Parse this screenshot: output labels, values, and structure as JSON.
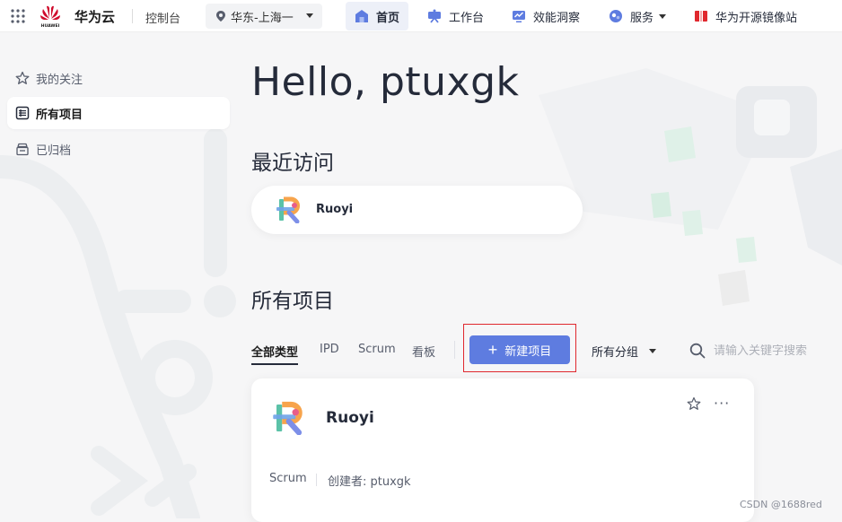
{
  "topbar": {
    "brand": "华为云",
    "logo_text": "HUAWEI",
    "console": "控制台",
    "region": "华东-上海一",
    "nav": [
      {
        "label": "首页",
        "icon": "home-icon"
      },
      {
        "label": "工作台",
        "icon": "workbench-icon"
      },
      {
        "label": "效能洞察",
        "icon": "insight-icon"
      },
      {
        "label": "服务",
        "icon": "service-icon"
      },
      {
        "label": "华为开源镜像站",
        "icon": "mirror-icon"
      }
    ]
  },
  "sidebar": {
    "items": [
      {
        "label": "我的关注",
        "icon": "star-icon"
      },
      {
        "label": "所有项目",
        "icon": "project-list-icon"
      },
      {
        "label": "已归档",
        "icon": "archive-icon"
      }
    ]
  },
  "main": {
    "greeting": "Hello, ptuxgk",
    "recent_title": "最近访问",
    "recent_items": [
      {
        "name": "Ruoyi"
      }
    ],
    "all_title": "所有项目",
    "filters": [
      "全部类型",
      "IPD",
      "Scrum",
      "看板"
    ],
    "new_project_label": "新建项目",
    "group_select": "所有分组",
    "search_placeholder": "请输入关键字搜索",
    "projects": [
      {
        "name": "Ruoyi",
        "type": "Scrum",
        "creator": "创建者: ptuxgk",
        "more": "···"
      }
    ]
  },
  "watermark": "CSDN @1688red",
  "colors": {
    "primary": "#5e7ce0",
    "highlight": "#e0282e",
    "brand_red": "#cf0a2c"
  }
}
